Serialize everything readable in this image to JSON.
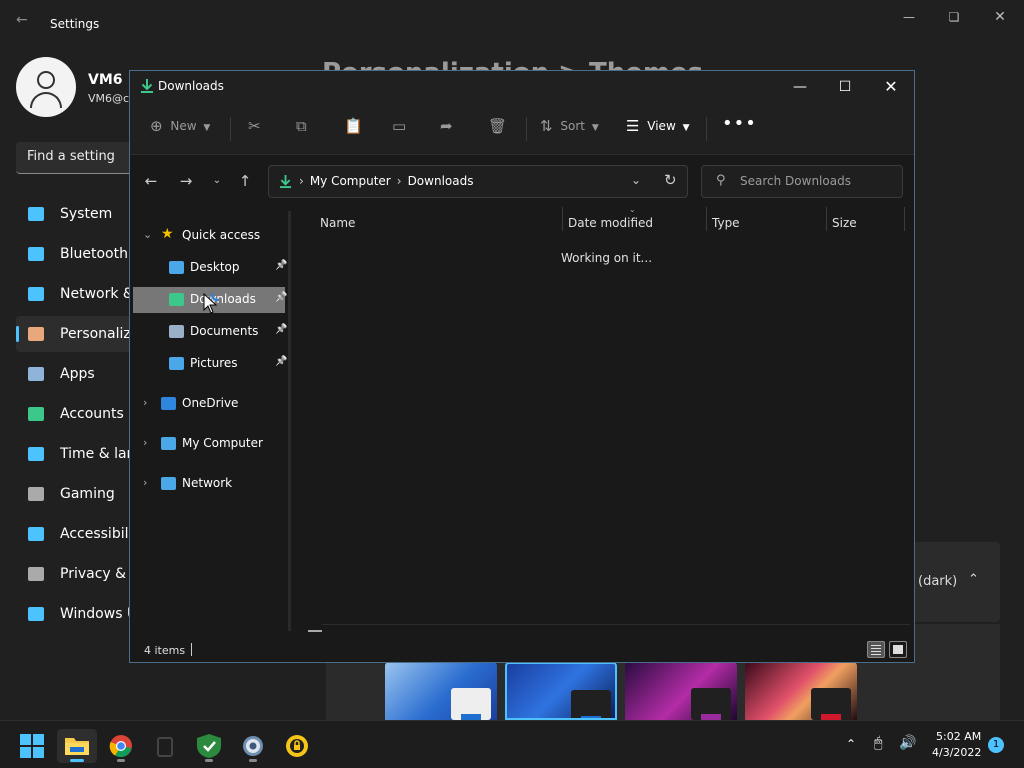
{
  "settings": {
    "title": "Settings",
    "user": {
      "name": "VM6",
      "email": "VM6@c"
    },
    "search_placeholder": "Find a setting",
    "heading": "Personalization > Themes",
    "nav": [
      {
        "label": "System",
        "icon": "monitor-icon",
        "color": "#4cc2ff"
      },
      {
        "label": "Bluetooth &",
        "icon": "bluetooth-icon",
        "color": "#4cc2ff"
      },
      {
        "label": "Network &",
        "icon": "wifi-icon",
        "color": "#4cc2ff"
      },
      {
        "label": "Personaliza",
        "icon": "brush-icon",
        "color": "#e8a87c"
      },
      {
        "label": "Apps",
        "icon": "apps-icon",
        "color": "#8fb3d9"
      },
      {
        "label": "Accounts",
        "icon": "person-icon",
        "color": "#3cc88b"
      },
      {
        "label": "Time & lang",
        "icon": "clock-icon",
        "color": "#4cc2ff"
      },
      {
        "label": "Gaming",
        "icon": "controller-icon",
        "color": "#aaaaaa"
      },
      {
        "label": "Accessibility",
        "icon": "accessibility-icon",
        "color": "#4cc2ff"
      },
      {
        "label": "Privacy & s",
        "icon": "shield-icon",
        "color": "#aaaaaa"
      },
      {
        "label": "Windows U",
        "icon": "update-icon",
        "color": "#4cc2ff"
      }
    ],
    "theme_row_value": "(dark)"
  },
  "explorer": {
    "title": "Downloads",
    "toolbar": {
      "new": "New",
      "sort": "Sort",
      "view": "View"
    },
    "address": {
      "root": "My Computer",
      "current": "Downloads"
    },
    "search_placeholder": "Search Downloads",
    "navpane": {
      "quick_access": "Quick access",
      "items": [
        {
          "label": "Desktop",
          "icon": "desktop-icon",
          "pinned": true
        },
        {
          "label": "Downloads",
          "icon": "download-icon",
          "pinned": true,
          "selected": true
        },
        {
          "label": "Documents",
          "icon": "document-icon",
          "pinned": true
        },
        {
          "label": "Pictures",
          "icon": "pictures-icon",
          "pinned": true
        }
      ],
      "roots": [
        {
          "label": "OneDrive",
          "icon": "cloud-icon"
        },
        {
          "label": "My Computer",
          "icon": "computer-icon"
        },
        {
          "label": "Network",
          "icon": "network-icon"
        }
      ]
    },
    "columns": [
      "Name",
      "Date modified",
      "Type",
      "Size"
    ],
    "loading_text": "Working on it...",
    "status": "4 items"
  },
  "taskbar": {
    "apps": [
      "start",
      "file-explorer",
      "chrome",
      "notepad",
      "defender",
      "settings",
      "norton"
    ],
    "time": "5:02 AM",
    "date": "4/3/2022",
    "notifications": "1"
  }
}
